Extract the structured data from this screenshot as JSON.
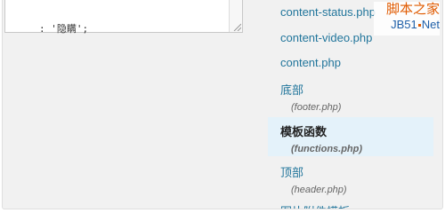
{
  "editor": {
    "code_line": ": '隐瞒';"
  },
  "files": [
    {
      "label": "content-status.php"
    },
    {
      "label": "content-video.php"
    },
    {
      "label": "content.php"
    },
    {
      "label": "底部",
      "sub": "(footer.php)"
    },
    {
      "label": "模板函数",
      "sub": "(functions.php)",
      "active": true
    },
    {
      "label": "顶部",
      "sub": "(header.php)"
    },
    {
      "label": "图片附件模板"
    }
  ],
  "watermark": {
    "top": "脚本之家",
    "bottom_left": "JB51",
    "bottom_right": "Net"
  },
  "colors": {
    "link": "#21759b",
    "active_bg": "#e4f2fa",
    "panel_bg": "#f1f1f1"
  }
}
